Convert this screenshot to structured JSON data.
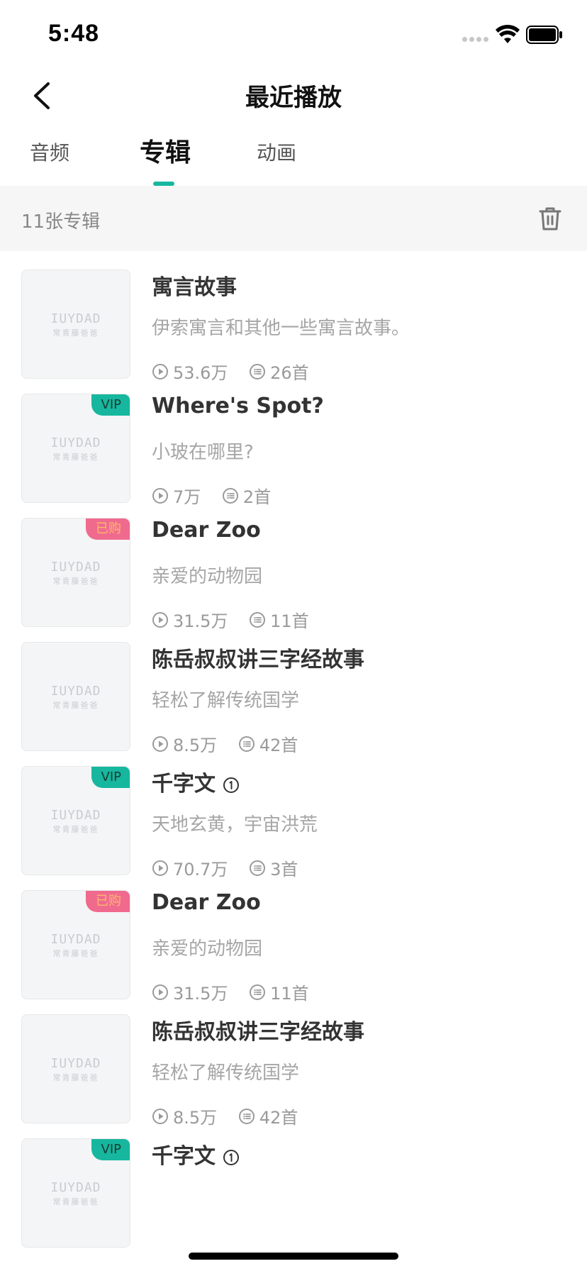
{
  "status_bar": {
    "time": "5:48"
  },
  "nav": {
    "title": "最近播放"
  },
  "tabs": [
    {
      "label": "音频"
    },
    {
      "label": "专辑"
    },
    {
      "label": "动画"
    }
  ],
  "summary": {
    "count_text": "11张专辑"
  },
  "cover_placeholder": {
    "logo": "IUYDAD",
    "sub": "常青藤爸爸"
  },
  "colors": {
    "accent": "#16b79e",
    "vip_badge": "#16b79e",
    "bought_badge": "#f06a8e"
  },
  "albums": [
    {
      "title": "寓言故事",
      "desc": "伊索寓言和其他一些寓言故事。",
      "plays": "53.6万",
      "tracks": "26首",
      "badge": ""
    },
    {
      "title": "Where's Spot?",
      "desc": "小玻在哪里?",
      "plays": "7万",
      "tracks": "2首",
      "badge": "VIP"
    },
    {
      "title": "Dear Zoo",
      "desc": "亲爱的动物园",
      "plays": "31.5万",
      "tracks": "11首",
      "badge": "已购"
    },
    {
      "title": "陈岳叔叔讲三字经故事",
      "desc": "轻松了解传统国学",
      "plays": "8.5万",
      "tracks": "42首",
      "badge": ""
    },
    {
      "title": "千字文",
      "desc": "天地玄黄，宇宙洪荒",
      "plays": "70.7万",
      "tracks": "3首",
      "badge": "VIP",
      "info_icon": true
    },
    {
      "title": "Dear Zoo",
      "desc": "亲爱的动物园",
      "plays": "31.5万",
      "tracks": "11首",
      "badge": "已购"
    },
    {
      "title": "陈岳叔叔讲三字经故事",
      "desc": "轻松了解传统国学",
      "plays": "8.5万",
      "tracks": "42首",
      "badge": ""
    },
    {
      "title": "千字文",
      "desc": "",
      "plays": "",
      "tracks": "",
      "badge": "VIP",
      "info_icon": true
    }
  ]
}
